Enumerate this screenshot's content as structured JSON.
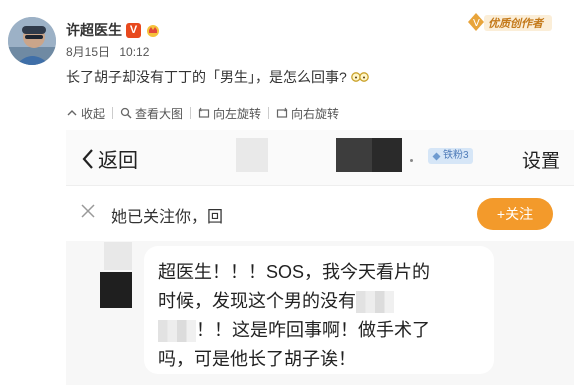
{
  "post": {
    "author": "许超医生",
    "date": "8月15日",
    "time": "10:12",
    "text": "长了胡子却没有丁丁的「男生」，是怎么回事?",
    "brand_badge_text": "优质创作者",
    "verified_mark": "V"
  },
  "actions": {
    "collapse": "收起",
    "view_large": "查看大图",
    "rotate_left": "向左旋转",
    "rotate_right": "向右旋转"
  },
  "screenshot": {
    "back_label": "返回",
    "fans_badge": "铁粉3",
    "settings_label": "设置",
    "follow_notice": "她已关注你，回",
    "follow_button": "+关注",
    "message_line1": "超医生！！！SOS，我今天看片的",
    "message_line2": "时候，发现这个男的没有",
    "message_line3": "！！这是咋回事啊！做手术了",
    "message_line4": "吗，可是他长了胡子诶！"
  },
  "colors": {
    "accent_orange": "#f39a2b",
    "verified_red": "#e8491d",
    "fans_blue": "#4e7bb8"
  }
}
